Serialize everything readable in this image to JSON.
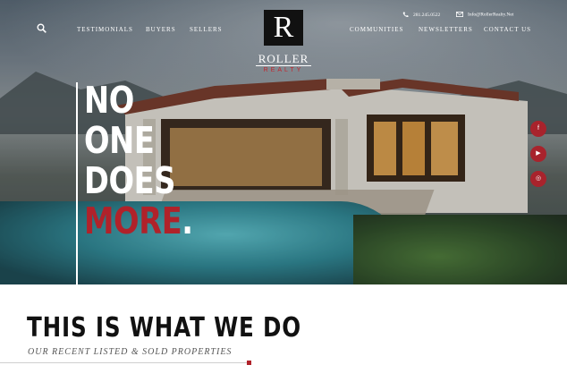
{
  "header": {
    "nav_left": [
      "TESTIMONIALS",
      "BUYERS",
      "SELLERS"
    ],
    "nav_right": [
      "COMMUNITIES",
      "NEWSLETTERS",
      "CONTACT US"
    ],
    "phone": "281.245.0522",
    "email": "Info@RollerRealty.Net"
  },
  "logo": {
    "letter": "R",
    "name": "ROLLER",
    "sub": "REALTY"
  },
  "hero": {
    "line1": "NO",
    "line2": "ONE",
    "line3": "DOES",
    "line4": "MORE",
    "period": "."
  },
  "social": {
    "facebook": "f",
    "youtube": "▶",
    "instagram": "◎"
  },
  "section": {
    "title": "THIS IS WHAT WE DO",
    "subtitle": "OUR RECENT LISTED & SOLD PROPERTIES"
  },
  "colors": {
    "accent": "#b0222a",
    "logo_red": "#c2262e"
  }
}
